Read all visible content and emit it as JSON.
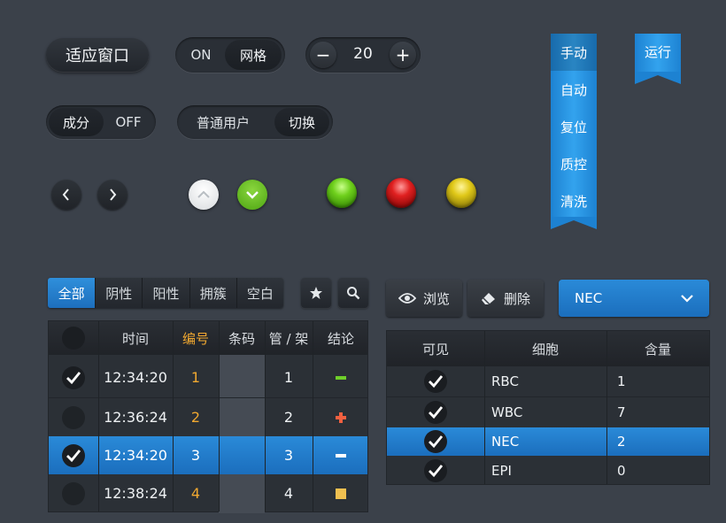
{
  "top": {
    "fit_window": "适应窗口",
    "toggle1": {
      "on": "ON",
      "off": "网格"
    },
    "stepper": {
      "value": "20",
      "minus": "−",
      "plus": "+"
    },
    "toggle2": {
      "left": "成分",
      "right": "OFF"
    },
    "toggle3": {
      "left": "普通用户",
      "right": "切换"
    }
  },
  "ribbon_menu": [
    "手动",
    "自动",
    "复位",
    "质控",
    "清洗"
  ],
  "run_ribbon": "运行",
  "filter_tabs": [
    "全部",
    "阴性",
    "阳性",
    "拥簇",
    "空白"
  ],
  "left_table": {
    "headers": [
      "时间",
      "编号",
      "条码",
      "管 / 架",
      "结论"
    ],
    "rows": [
      {
        "checked": true,
        "time": "12:34:20",
        "id": "1",
        "barcode": "",
        "tube": "1",
        "result": "minus",
        "selected": false
      },
      {
        "checked": false,
        "time": "12:36:24",
        "id": "2",
        "barcode": "",
        "tube": "2",
        "result": "plus",
        "selected": false
      },
      {
        "checked": true,
        "time": "12:34:20",
        "id": "3",
        "barcode": "",
        "tube": "3",
        "result": "minus",
        "selected": true
      },
      {
        "checked": false,
        "time": "12:38:24",
        "id": "4",
        "barcode": "",
        "tube": "4",
        "result": "square",
        "selected": false
      }
    ]
  },
  "actions": {
    "browse": "浏览",
    "delete": "删除"
  },
  "dropdown": {
    "value": "NEC"
  },
  "right_table": {
    "headers": [
      "可见",
      "细胞",
      "含量"
    ],
    "rows": [
      {
        "visible": true,
        "cell": "RBC",
        "amount": "1",
        "selected": false
      },
      {
        "visible": true,
        "cell": "WBC",
        "amount": "7",
        "selected": false
      },
      {
        "visible": true,
        "cell": "NEC",
        "amount": "2",
        "selected": true
      },
      {
        "visible": true,
        "cell": "EPI",
        "amount": "0",
        "selected": false
      }
    ]
  },
  "colors": {
    "accent_blue": "#1f78c8",
    "orange_id": "#f0a830",
    "green_light": "#5fbf1a",
    "red_light": "#d61818",
    "yellow_light": "#d8c012"
  }
}
